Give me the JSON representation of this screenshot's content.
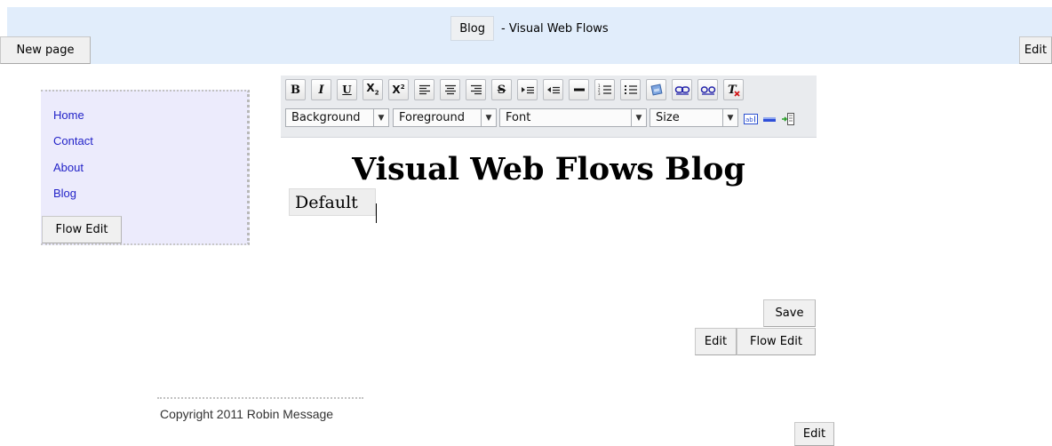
{
  "header": {
    "title_button": "Blog",
    "title_suffix": "- Visual Web Flows",
    "new_page_label": "New page",
    "edit_label": "Edit"
  },
  "sidebar": {
    "links": [
      "Home",
      "Contact",
      "About",
      "Blog"
    ],
    "flow_edit_label": "Flow Edit"
  },
  "toolbar": {
    "icons": [
      "bold-icon",
      "italic-icon",
      "underline-icon",
      "subscript-icon",
      "superscript-icon",
      "align-left-icon",
      "align-center-icon",
      "align-right-icon",
      "strikethrough-icon",
      "indent-icon",
      "outdent-icon",
      "horizontal-rule-icon",
      "ordered-list-icon",
      "unordered-list-icon",
      "image-icon",
      "link-icon",
      "unlink-icon",
      "remove-format-icon",
      "text-field-icon",
      "highlight-icon",
      "html-icon"
    ],
    "background_label": "Background",
    "foreground_label": "Foreground",
    "font_label": "Font",
    "size_label": "Size"
  },
  "content": {
    "heading": "Visual Web Flows Blog",
    "format_block": "Default",
    "save_label": "Save",
    "edit_label": "Edit",
    "flow_edit_label": "Flow Edit"
  },
  "footer": {
    "copyright": "Copyright 2011 Robin Message",
    "edit_label": "Edit"
  },
  "colors": {
    "header_bg": "#e1edfb",
    "sidebar_bg": "#ecebfc",
    "link": "#2323c8",
    "toolbar_bg": "#e9ebee"
  }
}
